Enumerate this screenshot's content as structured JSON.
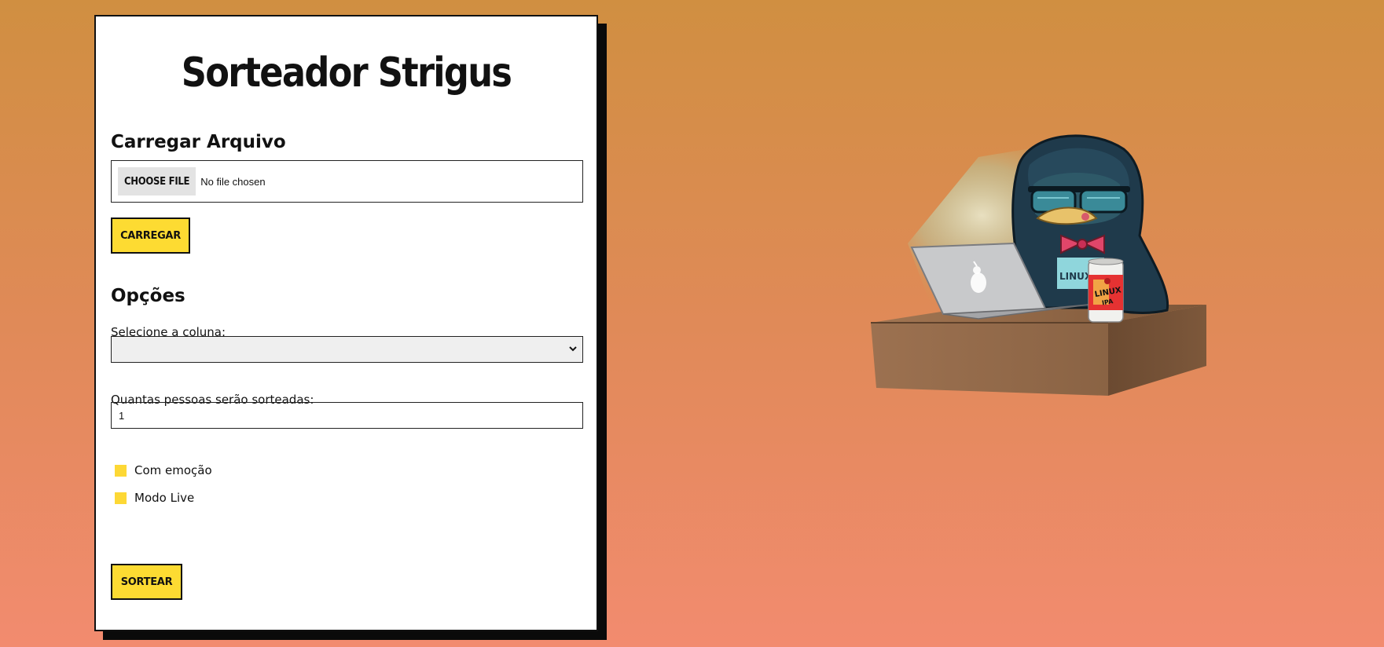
{
  "app": {
    "title": "Sorteador Strigus"
  },
  "upload": {
    "heading": "Carregar Arquivo",
    "file_button_label": "CHOOSE FILE",
    "file_status": "No file chosen",
    "load_button_label": "CARREGAR"
  },
  "options": {
    "heading": "Opções",
    "column_label": "Selecione a coluna:",
    "column_selected": "",
    "count_label": "Quantas pessoas serão sorteadas:",
    "count_value": "1",
    "checkboxes": [
      {
        "label": "Com emoção",
        "checked": false
      },
      {
        "label": "Modo Live",
        "checked": false
      }
    ],
    "draw_button_label": "SORTEAR"
  },
  "illustration": {
    "can_text_line1": "LINUX",
    "can_text_line2": "IPA",
    "shirt_text": "LINUX"
  },
  "colors": {
    "accent_yellow": "#fddb32",
    "background_top": "#d08f41",
    "background_bottom": "#f28b6f"
  }
}
